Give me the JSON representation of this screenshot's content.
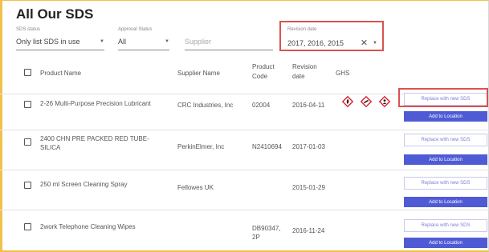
{
  "title": "All Our SDS",
  "filters": {
    "sds_status": {
      "label": "SDS status",
      "value": "Only list SDS in use"
    },
    "approval_status": {
      "label": "Approval Status",
      "value": "All"
    },
    "supplier": {
      "placeholder": "Supplier"
    },
    "revision_date": {
      "label": "Revision date",
      "value": "2017, 2016, 2015"
    }
  },
  "table": {
    "headers": {
      "product_name": "Product Name",
      "supplier_name": "Supplier Name",
      "product_code": "Product\nCode",
      "revision_date": "Revision\ndate",
      "ghs": "GHS"
    },
    "rows": [
      {
        "product": "2-26 Multi-Purpose Precision Lubricant",
        "supplier": "CRC Industries, Inc",
        "code": "02004",
        "date": "2016-04-11",
        "ghs": [
          "flammable-pictogram-icon",
          "exclamation-pictogram-icon",
          "health-hazard-pictogram-icon"
        ]
      },
      {
        "product": "2400 CHN PRE PACKED RED TUBE-\nSILICA",
        "supplier": "PerkinElmer, Inc",
        "code": "N2410694",
        "date": "2017-01-03",
        "ghs": []
      },
      {
        "product": "250 ml Screen Cleaning Spray",
        "supplier": "Fellowes UK",
        "code": "",
        "date": "2015-01-29",
        "ghs": []
      },
      {
        "product": "2work Telephone Cleaning Wipes",
        "supplier": "",
        "code": "DB90347,\n2P",
        "date": "2016-11-24",
        "ghs": []
      }
    ],
    "replace_label": "Replace with new SDS",
    "add_label": "Add to Location"
  },
  "colors": {
    "accent": "#4f5bd5",
    "highlight": "#d9534f",
    "ghs_red": "#d9232e"
  }
}
